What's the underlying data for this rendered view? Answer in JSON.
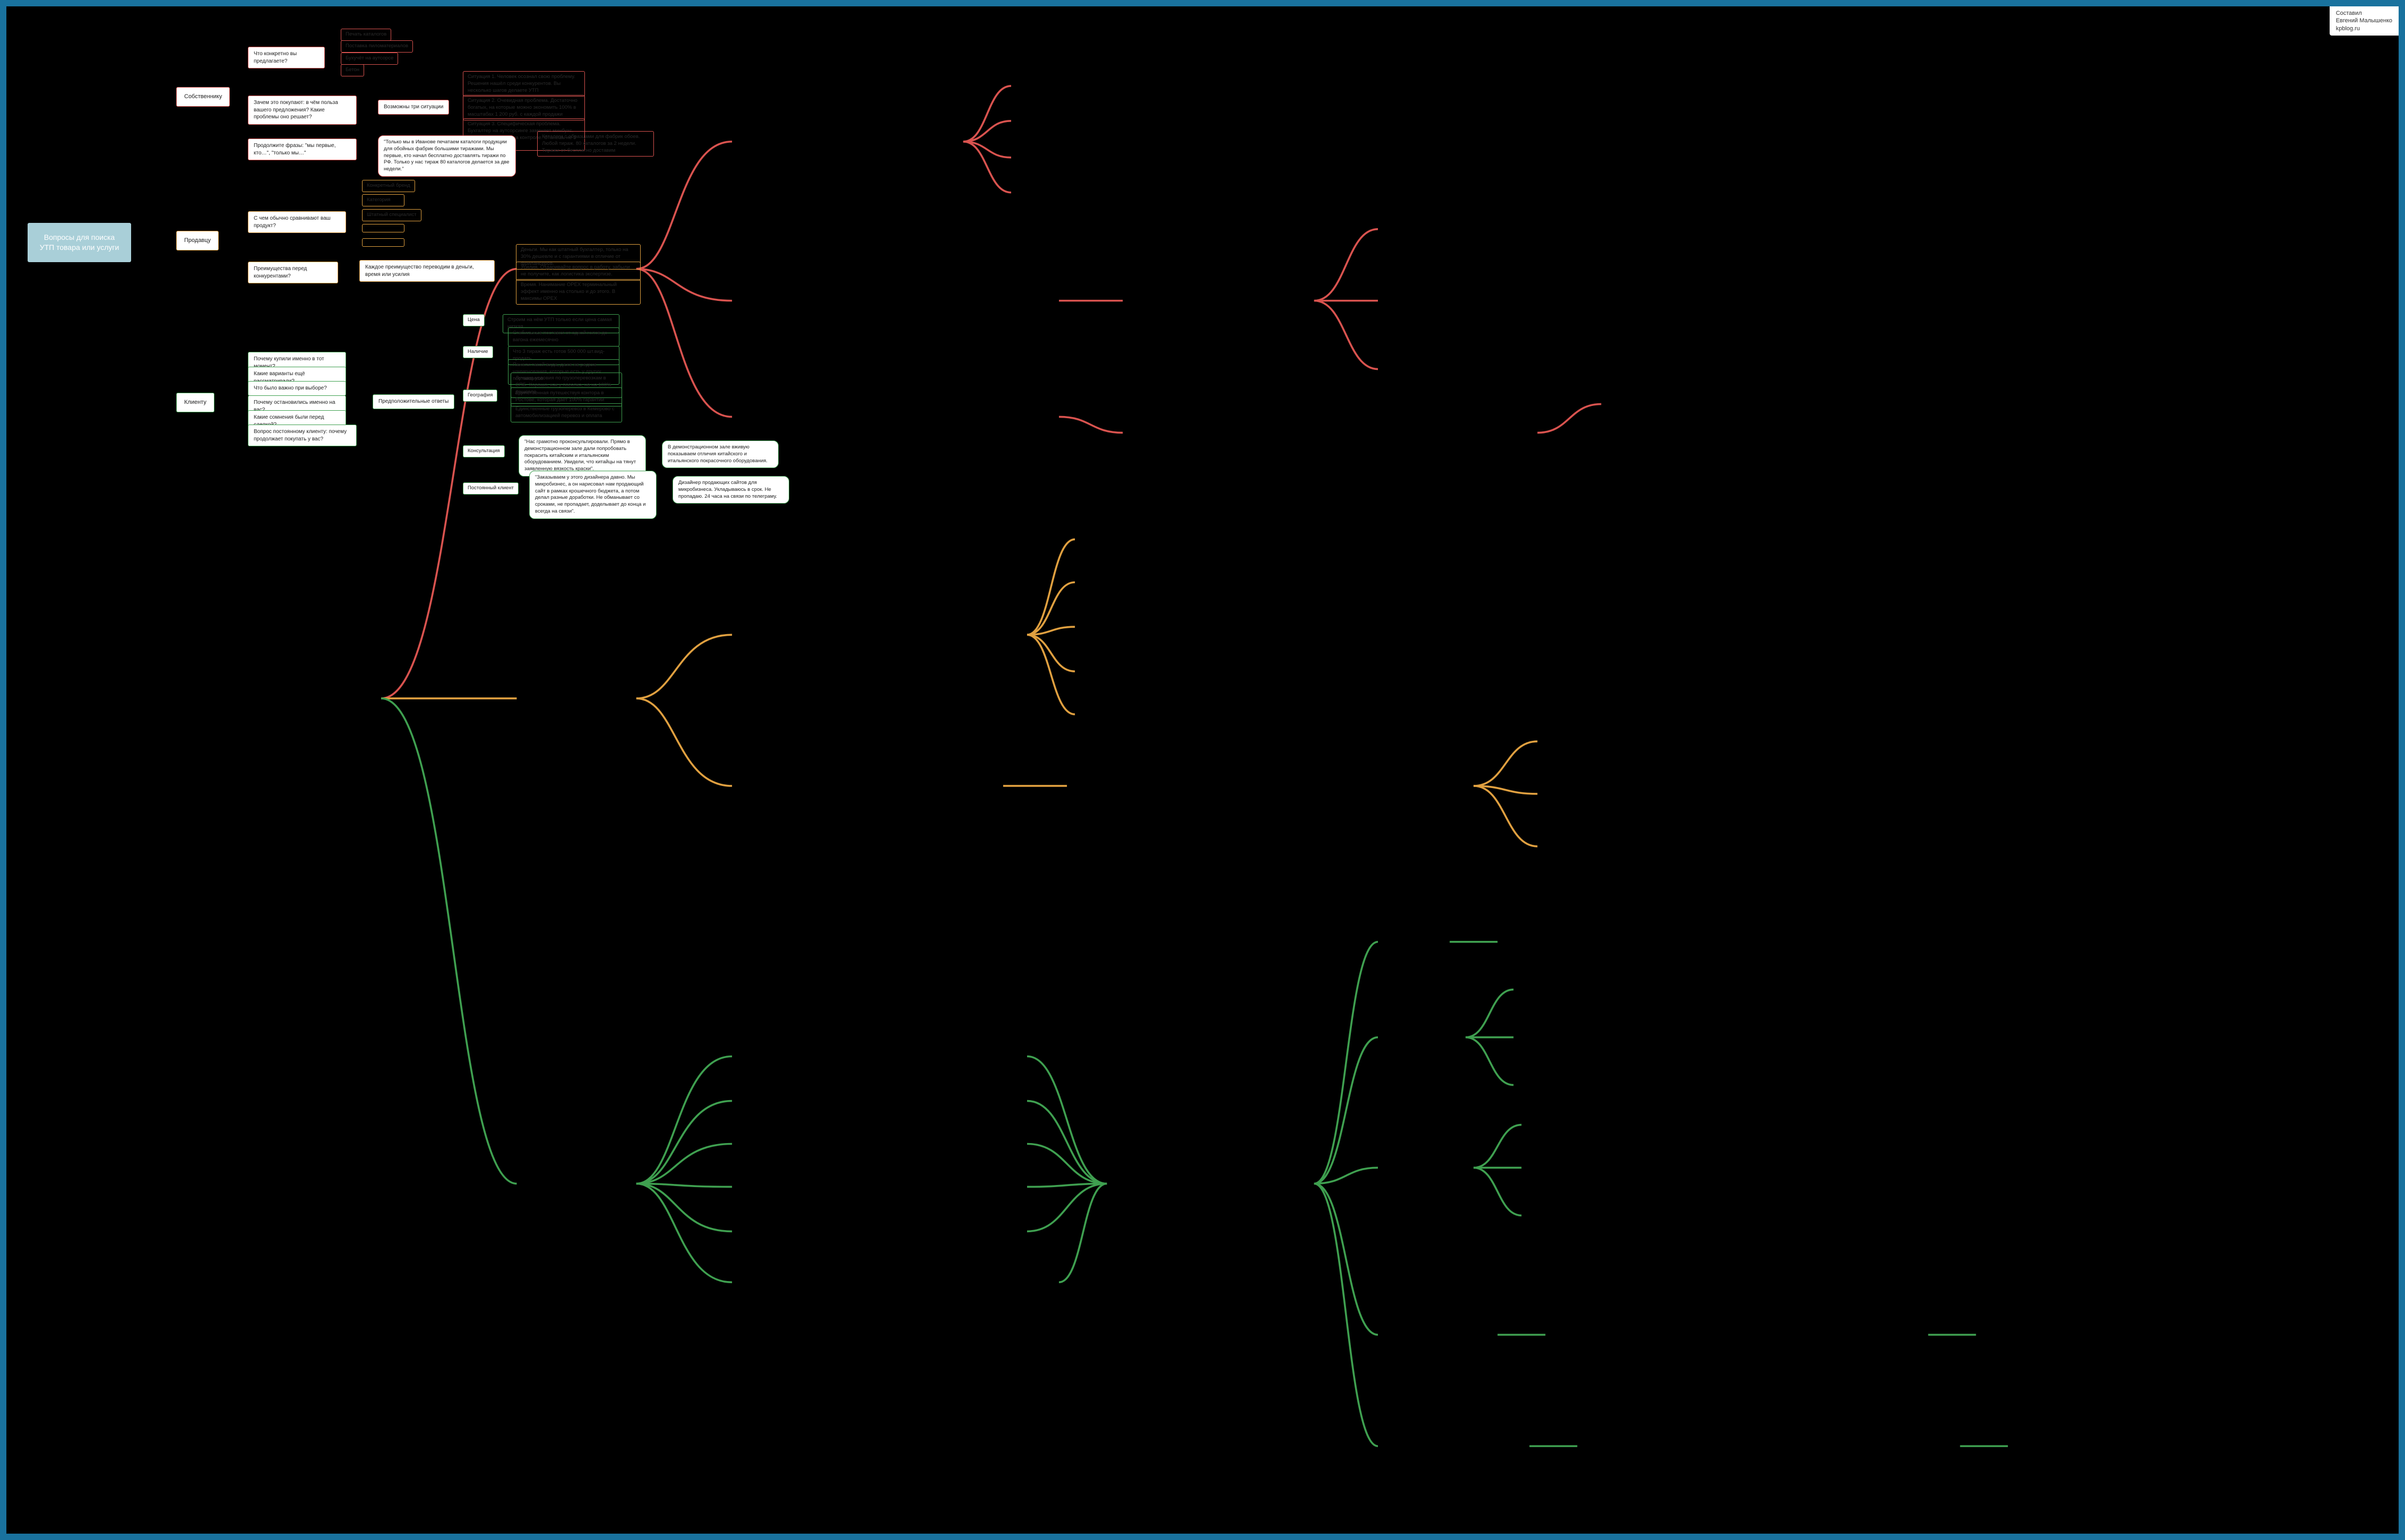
{
  "attribution": {
    "line1": "Составил",
    "line2": "Евгений Малышенко",
    "line3": "kpblog.ru"
  },
  "root": "Вопросы для поиска УТП товара или услуги",
  "owner": {
    "title": "Собственнику",
    "q1": {
      "text": "Что конкретно вы предлагаете?",
      "leaves": [
        "Печать каталогов",
        "Поставка пиломатериалов",
        "Бухучёт на аутсорсе",
        "Бетон"
      ]
    },
    "q2": {
      "text": "Зачем это покупают: в чём польза вашего предложения? Какие проблемы оно решает?",
      "sub": "Возможны три ситуации",
      "leaves": [
        "Ситуация 1. Человек осознал свою проблему. Решения нашёл среди конкурентов. Вы несколько шагов делаете УТП",
        "Ситуация 2. Очевидная проблема. Достаточно богатых, на которые можно экономить 100% в масштабах 1 200 руб. с каждой продажи",
        "Ситуация 3. Специфическая проблема. Бухгалтер на аутсорсинге заменяет минбухс, ниже в бухзатраты на контроле. Станешь не 3 меньше"
      ]
    },
    "q3": {
      "text": "Продолжите фразы: \"мы первые, кто…\", \"только мы…\"",
      "quote": "\"Только мы в Иванове печатаем каталоги продукции для обойных фабрик большими тиражами. Мы первые, кто начал бесплатно доставлять тиражи по РФ. Только у нас тираж 80 каталогов делается за две недели.\"",
      "leaf": "Каталоги с образцами для фабрик обоев. Любой тираж. 80 каталогов за 2 недели. Тиражи от бесплатно доставим"
    }
  },
  "seller": {
    "title": "Продавцу",
    "q1": {
      "text": "С чем обычно сравнивают ваш продукт?",
      "leaves": [
        "Конкретный бренд",
        "Категория",
        "Штатный специалист",
        "",
        ""
      ]
    },
    "q2": {
      "text": "Преимущества перед конкурентами?",
      "sub": "Каждое преимущество переводим в деньги, время или усилия",
      "leaves": [
        "Деньги. Мы как штатный бухгалтер, только на 30% дешевле и с гарантиями в отличие от фрилансеров.",
        "Усилия. Отдаривайте вопрос в работу, забыли не получите, как логистика экспертизе.",
        "Время. Нанимание OPEX терминальный эффект именно на столько и до этого. В максимы OPEX"
      ]
    }
  },
  "client": {
    "title": "Клиенту",
    "questions": [
      "Почему купили именно в тот момент?",
      "Какие варианты ещё рассматривали?",
      "Что было важно при выборе?",
      "Почему остановились именно на вас?",
      "Какие сомнения были перед сделкой?",
      "Вопрос постоянному клиенту: почему продолжает покупать у вас?"
    ],
    "answers_title": "Предположительные ответы",
    "price": {
      "label": "Цена",
      "leaves": [
        "Строим на нём УТП только если цена самая низкая"
      ]
    },
    "stock": {
      "label": "Наличие",
      "leaves": [
        "Стабильные поставки от одной голов до вагона ежемесячно",
        "Что 3 тираж есть готов 500 000 шт.вид-продать",
        "Панели такой вида, даже не редкие наименования, которые есть у других поставщиков"
      ]
    },
    "geo": {
      "label": "География",
      "leaves": [
        "Лучшие условия по грузоперевозкам в СПБ. Хорошо, как у поселка, но на 100% дешевле",
        "Единственная путешествуя контора в Ростове, которая дает 100% гарантии",
        "Единственные грузоперевоз в Кемерово с автомобилизацией перевоз и оплата"
      ]
    },
    "consult": {
      "label": "Консультация",
      "quote": "\"Нас грамотно проконсультировали. Прямо в демонстрационном зале дали попробовать покрасить китайским и итальянским оборудованием. Увидели, что китайцы на тянут заявленную вязкость краски\".",
      "result": "В демонстрационном зале вживую показываем отличия китайского и итальянского покрасочного оборудования."
    },
    "regular": {
      "label": "Постоянный клиент",
      "quote": "\"Заказываем у этого дизайнера давно. Мы микробизнес, а он нарисовал нам  продающий сайт в рамках крошечного бюджета, а потом делал разные доработки. Не обманывает со сроками, не пропадает, доделывает до конца и всегда на связи\".",
      "result": "Дизайнер продающих сайтов для микробизнеса. Укладываюсь в срок. Не пропадаю. 24 часа на связи по телеграму."
    }
  }
}
